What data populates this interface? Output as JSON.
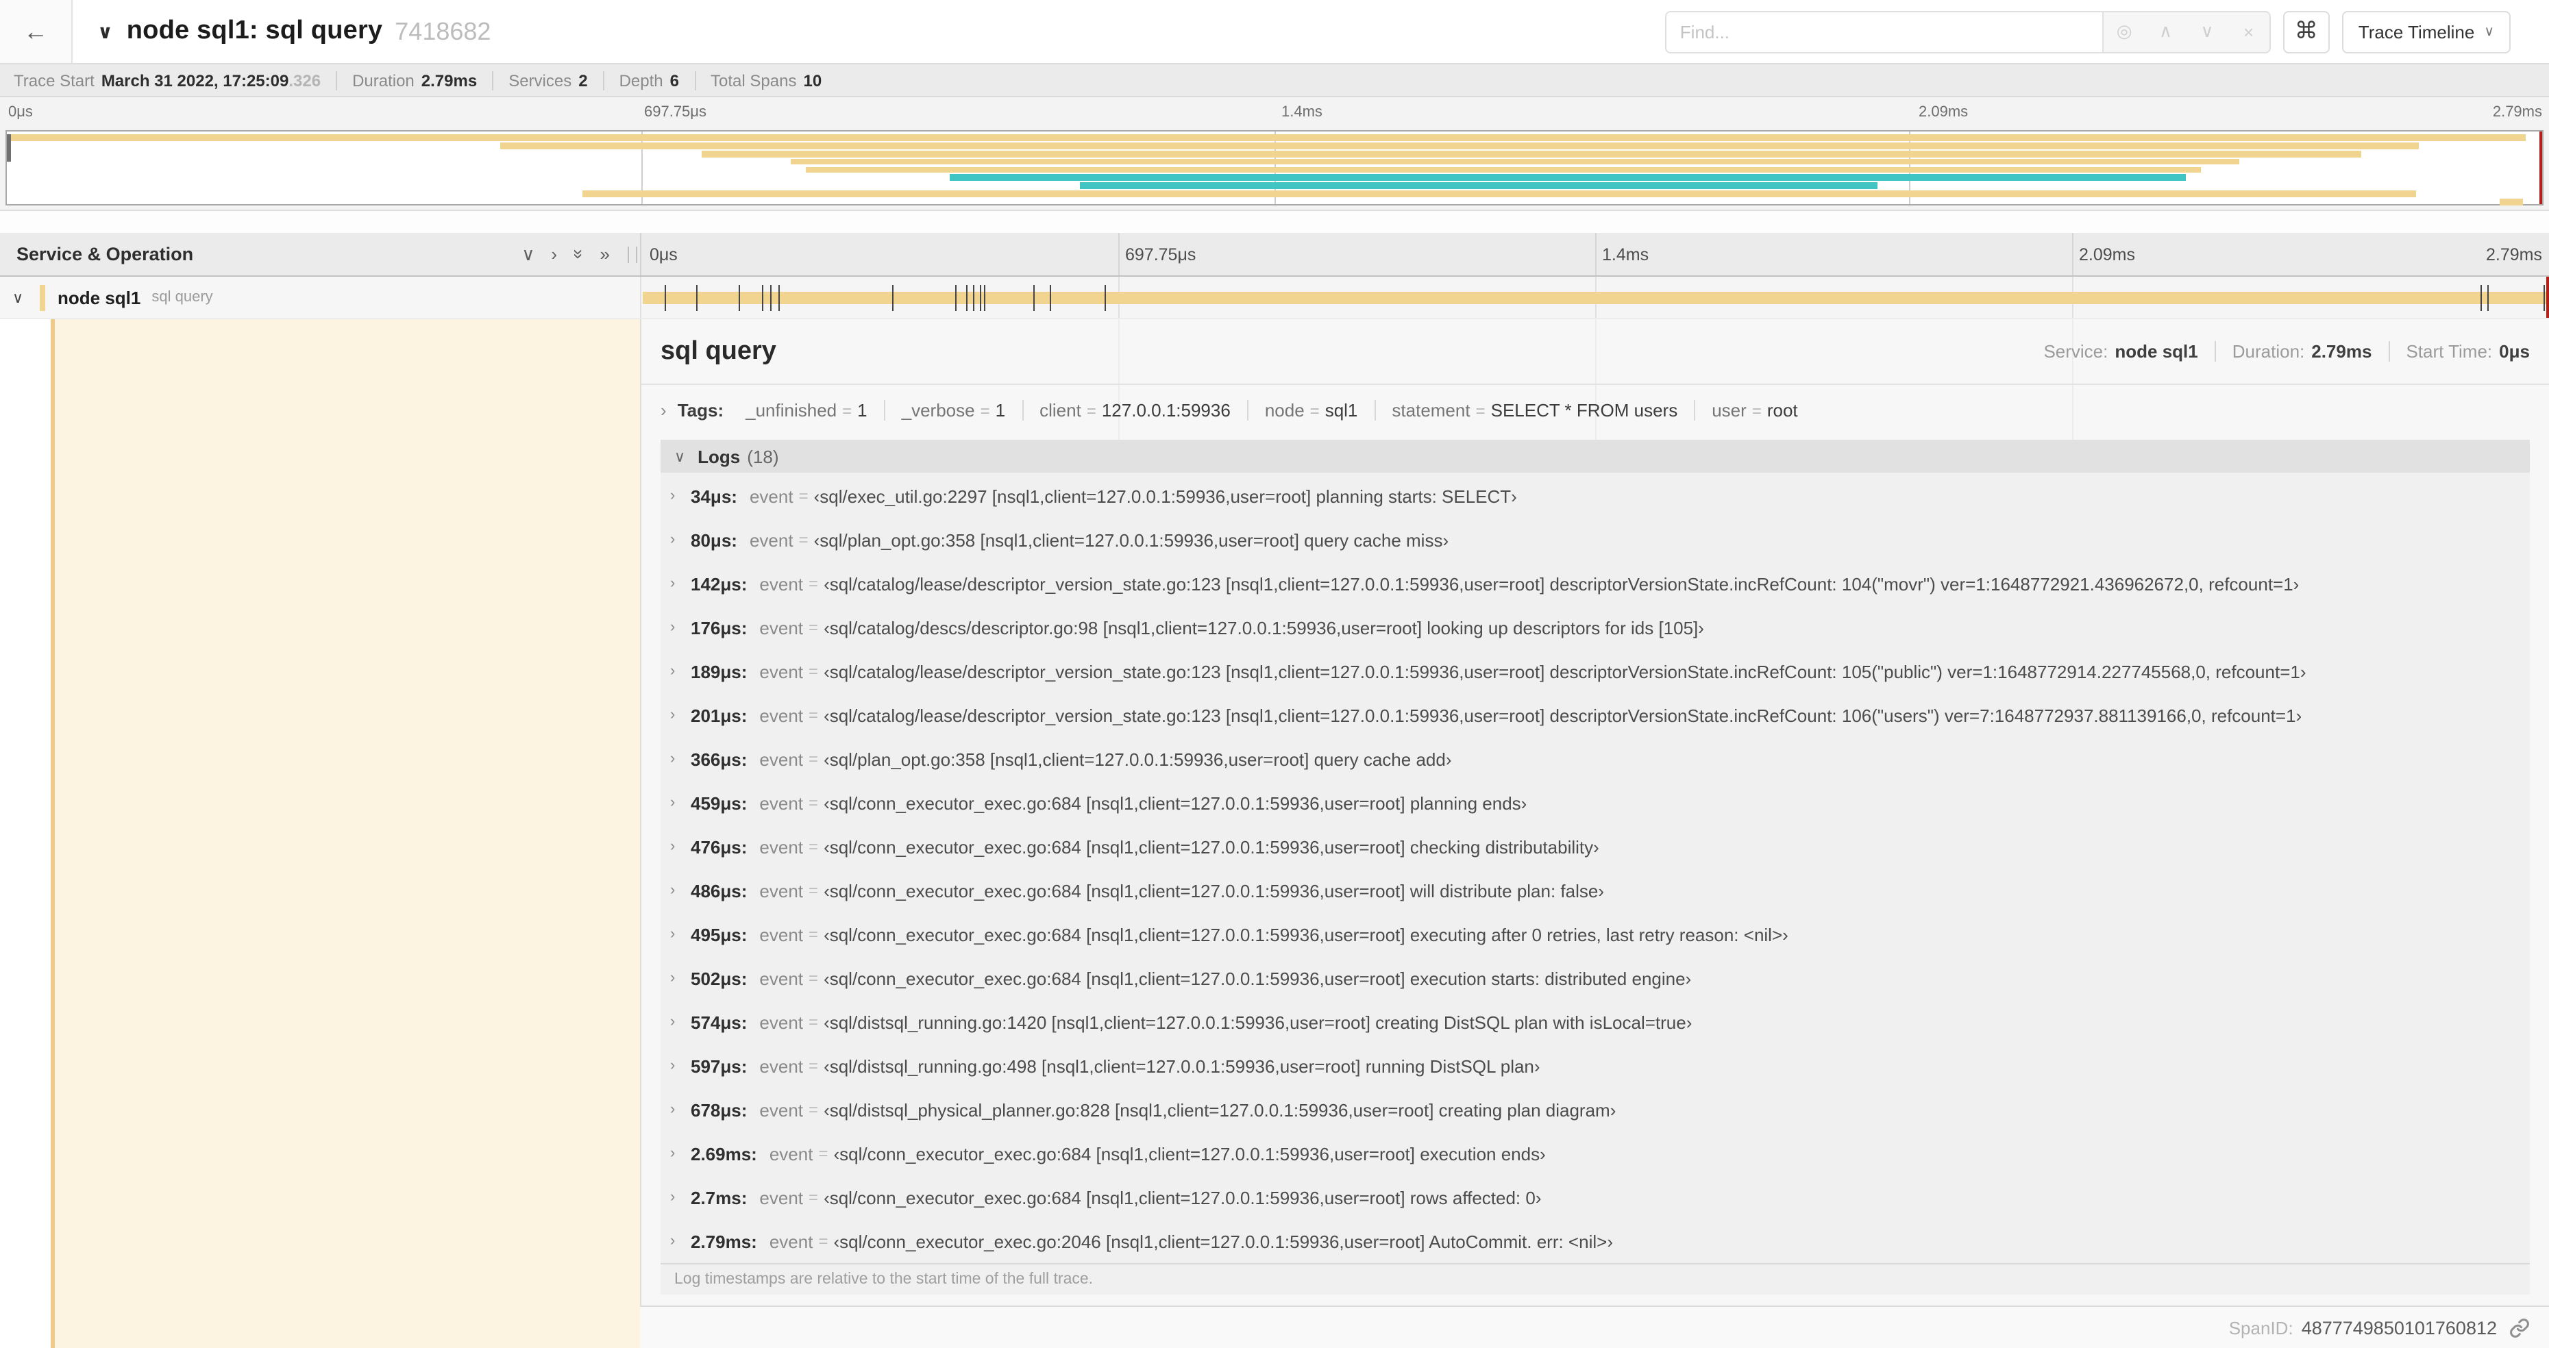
{
  "header": {
    "back_icon": "←",
    "collapse_icon": "∨",
    "title": "node sql1: sql query",
    "trace_id": "7418682",
    "find": {
      "placeholder": "Find...",
      "target_icon": "◎",
      "prev_icon": "∧",
      "next_icon": "∨",
      "clear_icon": "×"
    },
    "shortcuts_icon": "⌘",
    "view_dropdown": {
      "label": "Trace Timeline",
      "chevron": "∨"
    }
  },
  "summary": {
    "items": [
      {
        "label": "Trace Start",
        "value": "March 31 2022, 17:25:09",
        "suffix": ".326"
      },
      {
        "label": "Duration",
        "value": "2.79ms"
      },
      {
        "label": "Services",
        "value": "2"
      },
      {
        "label": "Depth",
        "value": "6"
      },
      {
        "label": "Total Spans",
        "value": "10"
      }
    ]
  },
  "timeline_ticks": [
    "0μs",
    "697.75μs",
    "1.4ms",
    "2.09ms",
    "2.79ms"
  ],
  "colors": {
    "span_tan": "#F2D491",
    "span_teal": "#41C4C4",
    "scrubber_red": "#B22018",
    "detail_cream": "#FCF4E0"
  },
  "minimap": {
    "spans": [
      {
        "start": 0,
        "end": 99.4,
        "color": "#F2D491"
      },
      {
        "start": 19.4,
        "end": 95.2,
        "color": "#F2D491"
      },
      {
        "start": 27.4,
        "end": 92.9,
        "color": "#F2D491"
      },
      {
        "start": 30.9,
        "end": 88.1,
        "color": "#F2D491"
      },
      {
        "start": 31.5,
        "end": 86.6,
        "color": "#F2D491"
      },
      {
        "start": 37.2,
        "end": 86.0,
        "color": "#41C4C4"
      },
      {
        "start": 42.3,
        "end": 73.8,
        "color": "#41C4C4"
      },
      {
        "start": 22.7,
        "end": 95.1,
        "color": "#F2D491"
      },
      {
        "start": 98.4,
        "end": 99.3,
        "color": "#F2D491"
      }
    ]
  },
  "columns": {
    "left_title": "Service & Operation",
    "collapse_all_icons": [
      "∨",
      "›",
      "»",
      "»"
    ]
  },
  "span_row": {
    "chevron": "∨",
    "service": "node sql1",
    "operation": "sql query",
    "total_us": 2790,
    "log_marker_times_us": [
      34,
      80,
      142,
      176,
      189,
      201,
      366,
      459,
      476,
      486,
      495,
      502,
      574,
      597,
      678,
      2690,
      2700,
      2790
    ]
  },
  "detail": {
    "title": "sql query",
    "info": [
      {
        "label": "Service:",
        "value": "node sql1"
      },
      {
        "label": "Duration:",
        "value": "2.79ms"
      },
      {
        "label": "Start Time:",
        "value": "0μs"
      }
    ],
    "tags": {
      "chevron": "›",
      "label": "Tags:",
      "equals": "=",
      "items": [
        {
          "key": "_unfinished",
          "value": "1"
        },
        {
          "key": "_verbose",
          "value": "1"
        },
        {
          "key": "client",
          "value": "127.0.0.1:59936"
        },
        {
          "key": "node",
          "value": "sql1"
        },
        {
          "key": "statement",
          "value": "SELECT * FROM users"
        },
        {
          "key": "user",
          "value": "root"
        }
      ]
    },
    "logs": {
      "chevron": "∨",
      "label": "Logs",
      "count": "(18)",
      "row_chevron": "›",
      "field_key": "event",
      "equals": "=",
      "entries": [
        {
          "time": "34μs:",
          "value": "‹sql/exec_util.go:2297 [nsql1,client=127.0.0.1:59936,user=root] planning starts: SELECT›"
        },
        {
          "time": "80μs:",
          "value": "‹sql/plan_opt.go:358 [nsql1,client=127.0.0.1:59936,user=root] query cache miss›"
        },
        {
          "time": "142μs:",
          "value": "‹sql/catalog/lease/descriptor_version_state.go:123 [nsql1,client=127.0.0.1:59936,user=root] descriptorVersionState.incRefCount: 104(\"movr\") ver=1:1648772921.436962672,0, refcount=1›"
        },
        {
          "time": "176μs:",
          "value": "‹sql/catalog/descs/descriptor.go:98 [nsql1,client=127.0.0.1:59936,user=root] looking up descriptors for ids [105]›"
        },
        {
          "time": "189μs:",
          "value": "‹sql/catalog/lease/descriptor_version_state.go:123 [nsql1,client=127.0.0.1:59936,user=root] descriptorVersionState.incRefCount: 105(\"public\") ver=1:1648772914.227745568,0, refcount=1›"
        },
        {
          "time": "201μs:",
          "value": "‹sql/catalog/lease/descriptor_version_state.go:123 [nsql1,client=127.0.0.1:59936,user=root] descriptorVersionState.incRefCount: 106(\"users\") ver=7:1648772937.881139166,0, refcount=1›"
        },
        {
          "time": "366μs:",
          "value": "‹sql/plan_opt.go:358 [nsql1,client=127.0.0.1:59936,user=root] query cache add›"
        },
        {
          "time": "459μs:",
          "value": "‹sql/conn_executor_exec.go:684 [nsql1,client=127.0.0.1:59936,user=root] planning ends›"
        },
        {
          "time": "476μs:",
          "value": "‹sql/conn_executor_exec.go:684 [nsql1,client=127.0.0.1:59936,user=root] checking distributability›"
        },
        {
          "time": "486μs:",
          "value": "‹sql/conn_executor_exec.go:684 [nsql1,client=127.0.0.1:59936,user=root] will distribute plan: false›"
        },
        {
          "time": "495μs:",
          "value": "‹sql/conn_executor_exec.go:684 [nsql1,client=127.0.0.1:59936,user=root] executing after 0 retries, last retry reason: <nil>›"
        },
        {
          "time": "502μs:",
          "value": "‹sql/conn_executor_exec.go:684 [nsql1,client=127.0.0.1:59936,user=root] execution starts: distributed engine›"
        },
        {
          "time": "574μs:",
          "value": "‹sql/distsql_running.go:1420 [nsql1,client=127.0.0.1:59936,user=root] creating DistSQL plan with isLocal=true›"
        },
        {
          "time": "597μs:",
          "value": "‹sql/distsql_running.go:498 [nsql1,client=127.0.0.1:59936,user=root] running DistSQL plan›"
        },
        {
          "time": "678μs:",
          "value": "‹sql/distsql_physical_planner.go:828 [nsql1,client=127.0.0.1:59936,user=root] creating plan diagram›"
        },
        {
          "time": "2.69ms:",
          "value": "‹sql/conn_executor_exec.go:684 [nsql1,client=127.0.0.1:59936,user=root] execution ends›"
        },
        {
          "time": "2.7ms:",
          "value": "‹sql/conn_executor_exec.go:684 [nsql1,client=127.0.0.1:59936,user=root] rows affected: 0›"
        },
        {
          "time": "2.79ms:",
          "value": "‹sql/conn_executor_exec.go:2046 [nsql1,client=127.0.0.1:59936,user=root] AutoCommit. err: <nil>›"
        }
      ],
      "footnote": "Log timestamps are relative to the start time of the full trace."
    },
    "span_id_label": "SpanID:",
    "span_id": "4877749850101760812"
  }
}
